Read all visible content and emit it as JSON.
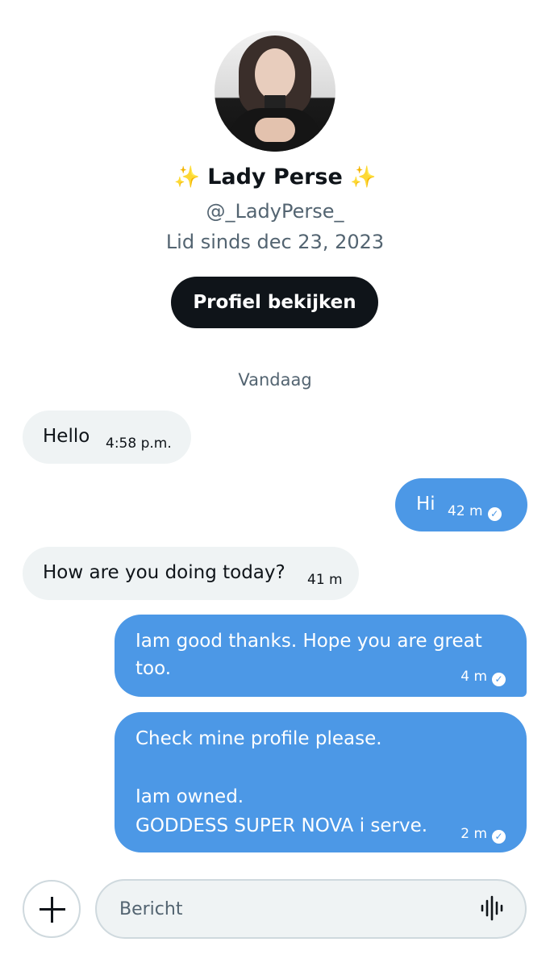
{
  "profile": {
    "name_prefix": "✨",
    "name": "Lady Perse",
    "name_suffix": "✨",
    "handle": "@_LadyPerse_",
    "member_since": "Lid sinds dec 23, 2023",
    "view_profile_button": "Profiel bekijken"
  },
  "day_separator": "Vandaag",
  "messages": [
    {
      "direction": "incoming",
      "text": "Hello",
      "time": "4:58 p.m."
    },
    {
      "direction": "outgoing",
      "text": "Hi",
      "time": "42 m",
      "status_icon": "sent-check-icon"
    },
    {
      "direction": "incoming",
      "text": "How are you doing today?",
      "time": "41 m"
    },
    {
      "direction": "outgoing",
      "text": "Iam good thanks. Hope you are great too.",
      "time": "4 m",
      "status_icon": "sent-check-icon"
    },
    {
      "direction": "outgoing",
      "lines": [
        "Check mine profile please.",
        "",
        "Iam owned.",
        "GODDESS SUPER NOVA i serve."
      ],
      "time": "2 m",
      "status_icon": "sent-check-icon"
    }
  ],
  "composer": {
    "add_icon": "plus-icon",
    "placeholder": "Bericht",
    "value": "",
    "voice_icon": "voice-waveform-icon"
  },
  "colors": {
    "outgoing_bubble": "#4c98e6",
    "incoming_bubble": "#eff3f4",
    "button": "#0f1419",
    "secondary_text": "#536471"
  }
}
